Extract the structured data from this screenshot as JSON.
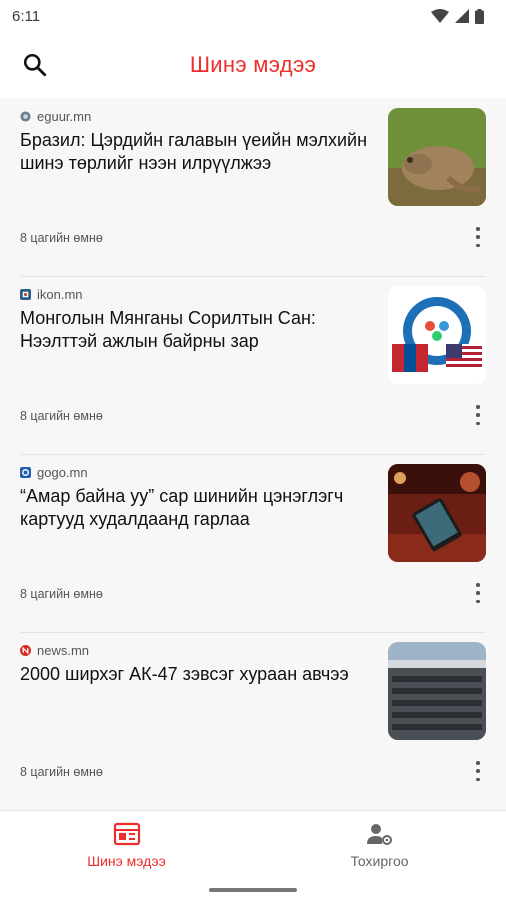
{
  "status_bar": {
    "time": "6:11",
    "icons": [
      "wifi-icon",
      "signal-icon",
      "battery-icon"
    ]
  },
  "app_bar": {
    "title": "Шинэ мэдээ",
    "search_icon": "search-icon"
  },
  "colors": {
    "accent": "#ee2d2d",
    "feed_background": "#f7f7f7"
  },
  "articles": [
    {
      "source": "eguur.mn",
      "source_icon": "globe-icon",
      "title": "Бразил: Цэрдийн галавын үеийн мэлхийн шинэ төрлийг нээн илрүүлжээ",
      "time": "8 цагийн өмнө",
      "thumbnail": "frog-photo"
    },
    {
      "source": "ikon.mn",
      "source_icon": "ikon-logo-icon",
      "title": "Монголын Мянганы Сорилтын Сан: Нээлттэй ажлын байрны зар",
      "time": "8 цагийн өмнө",
      "thumbnail": "mcf-logo-flags"
    },
    {
      "source": "gogo.mn",
      "source_icon": "gogo-logo-icon",
      "title": "“Амар байна уу” сар шинийн цэнэглэгч картууд худалдаанд гарлаа",
      "time": "8 цагийн өмнө",
      "thumbnail": "greeting-card-photo"
    },
    {
      "source": "news.mn",
      "source_icon": "news-logo-icon",
      "title": "2000 ширхэг АК-47 зэвсэг хураан авчээ",
      "time": "8 цагийн өмнө",
      "thumbnail": "rifles-photo"
    }
  ],
  "bottom_nav": [
    {
      "label": "Шинэ мэдээ",
      "icon": "newspaper-icon",
      "active": true
    },
    {
      "label": "Тохиргоо",
      "icon": "user-settings-icon",
      "active": false
    }
  ]
}
